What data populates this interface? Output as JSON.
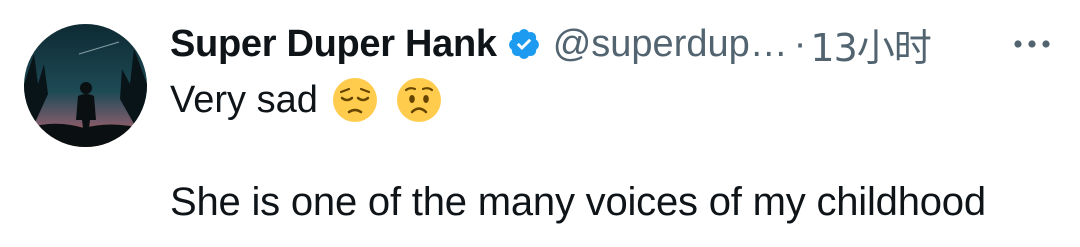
{
  "tweet": {
    "author": {
      "display_name": "Super Duper Hank",
      "handle": "@superdup…",
      "verified_icon": "verified-badge-icon",
      "verified_color": "#1d9bf0"
    },
    "separator": "·",
    "timestamp": "13小时",
    "more_icon": "more-horizontal-icon",
    "text": {
      "line1": "Very sad",
      "line1_emojis": [
        "pensive-face-emoji",
        "worried-face-emoji"
      ],
      "line2": "She is one of the many voices of my childhood"
    }
  },
  "colors": {
    "primary_text": "#0f1419",
    "secondary_text": "#536471",
    "background": "#ffffff"
  }
}
